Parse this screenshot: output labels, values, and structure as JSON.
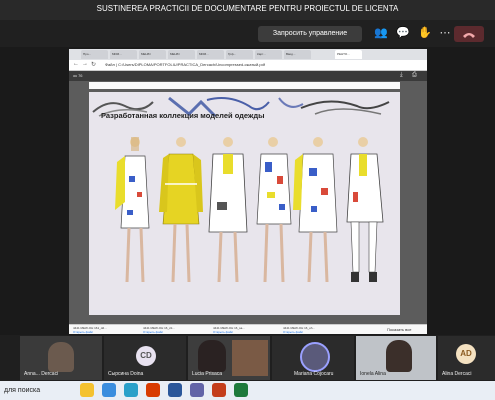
{
  "meeting": {
    "title": "SUSTINEREA PRACTICII DE DOCUMENTARE PENTRU PROIECTUL DE LICENTA",
    "request_control_label": "Запросить управление"
  },
  "browser": {
    "tabs": [
      "Про...",
      "MDM...",
      "МЕНЮ",
      "МЕНЮ",
      "MDM...",
      "Грф...",
      "Карт...",
      "Ввод...",
      "РЕНТО..."
    ],
    "url": "Файл  |  C:/Users/DIPLOMA/PORTFOLIU/PRACTICA_Dercach/Uncompressed-сжатый.pdf",
    "page_counter": "ок 76",
    "download_items": [
      {
        "name": "4441 MEW-OH 161_dd...",
        "sub": "Открыть файл"
      },
      {
        "name": "4441 MEW-OH 16_ctt...",
        "sub": "Открыть файл"
      },
      {
        "name": "4441 MEW-OH 16_sa...",
        "sub": "Открыть файл"
      },
      {
        "name": "4441 MEW-OH 16_oh...",
        "sub": "Открыть файл"
      }
    ],
    "show_all_label": "Показать все"
  },
  "slide": {
    "title": "Разработанная коллекция моделей одежды"
  },
  "participants": [
    {
      "name": "Anna... Dercaci",
      "initials": "",
      "kind": "video"
    },
    {
      "name": "Сырсина Doina",
      "initials": "CD",
      "kind": "avatar"
    },
    {
      "name": "Lucia Prisaca",
      "initials": "",
      "kind": "video"
    },
    {
      "name": "",
      "initials": "",
      "kind": "video"
    },
    {
      "name": "Mariana Cojocaru",
      "initials": "",
      "kind": "avatar-photo"
    },
    {
      "name": "Ionela Alina",
      "initials": "",
      "kind": "video"
    },
    {
      "name": "Alina Dercaci",
      "initials": "AD",
      "kind": "avatar"
    }
  ],
  "taskbar": {
    "search_placeholder": "для поиска"
  },
  "colors": {
    "accent": "#f6e34a",
    "teams_bg": "#1f1f1f",
    "avatar_cd": "#e8e2f0",
    "avatar_ad": "#f4e1c1"
  }
}
